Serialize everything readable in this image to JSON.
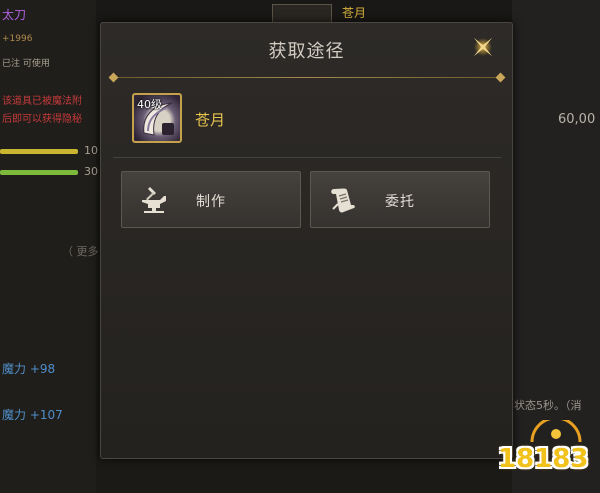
{
  "background": {
    "left_texts": [
      {
        "text": "太刀",
        "color": "#b060e0"
      },
      {
        "text": "+1996",
        "color": "#b08b4c"
      },
      {
        "text": "已注 可使用",
        "color": "#a8a090"
      },
      {
        "text": "该道具已被魔法附",
        "color": "#c43a3a"
      },
      {
        "text": "后即可以获得隐秘",
        "color": "#c43a3a"
      },
      {
        "text": "（ 更多",
        "color": "#6d6860"
      },
      {
        "text": "魔力 +98",
        "color": "#4f8fc8"
      },
      {
        "text": "魔力 +107",
        "color": "#4f8fc8"
      }
    ],
    "bar_labels": [
      "10",
      "30"
    ],
    "bar_colors": [
      "#c9b530",
      "#7dba3c"
    ],
    "right_texts": [
      {
        "text": "苍月",
        "color": "#d8b23c"
      },
      {
        "text": "60,00",
        "color": "#b8b2a8"
      },
      {
        "text": "状态5秒。（消",
        "color": "#9a958c"
      }
    ]
  },
  "dialog": {
    "title": "获取途径",
    "close_icon": "sparkle-close-icon",
    "item": {
      "level": "40级",
      "name": "苍月",
      "icon": "blade-crescent-icon"
    },
    "buttons": [
      {
        "label": "制作",
        "icon": "anvil-hammer-icon"
      },
      {
        "label": "委托",
        "icon": "scroll-icon"
      }
    ]
  },
  "watermark": {
    "text": "18183"
  }
}
